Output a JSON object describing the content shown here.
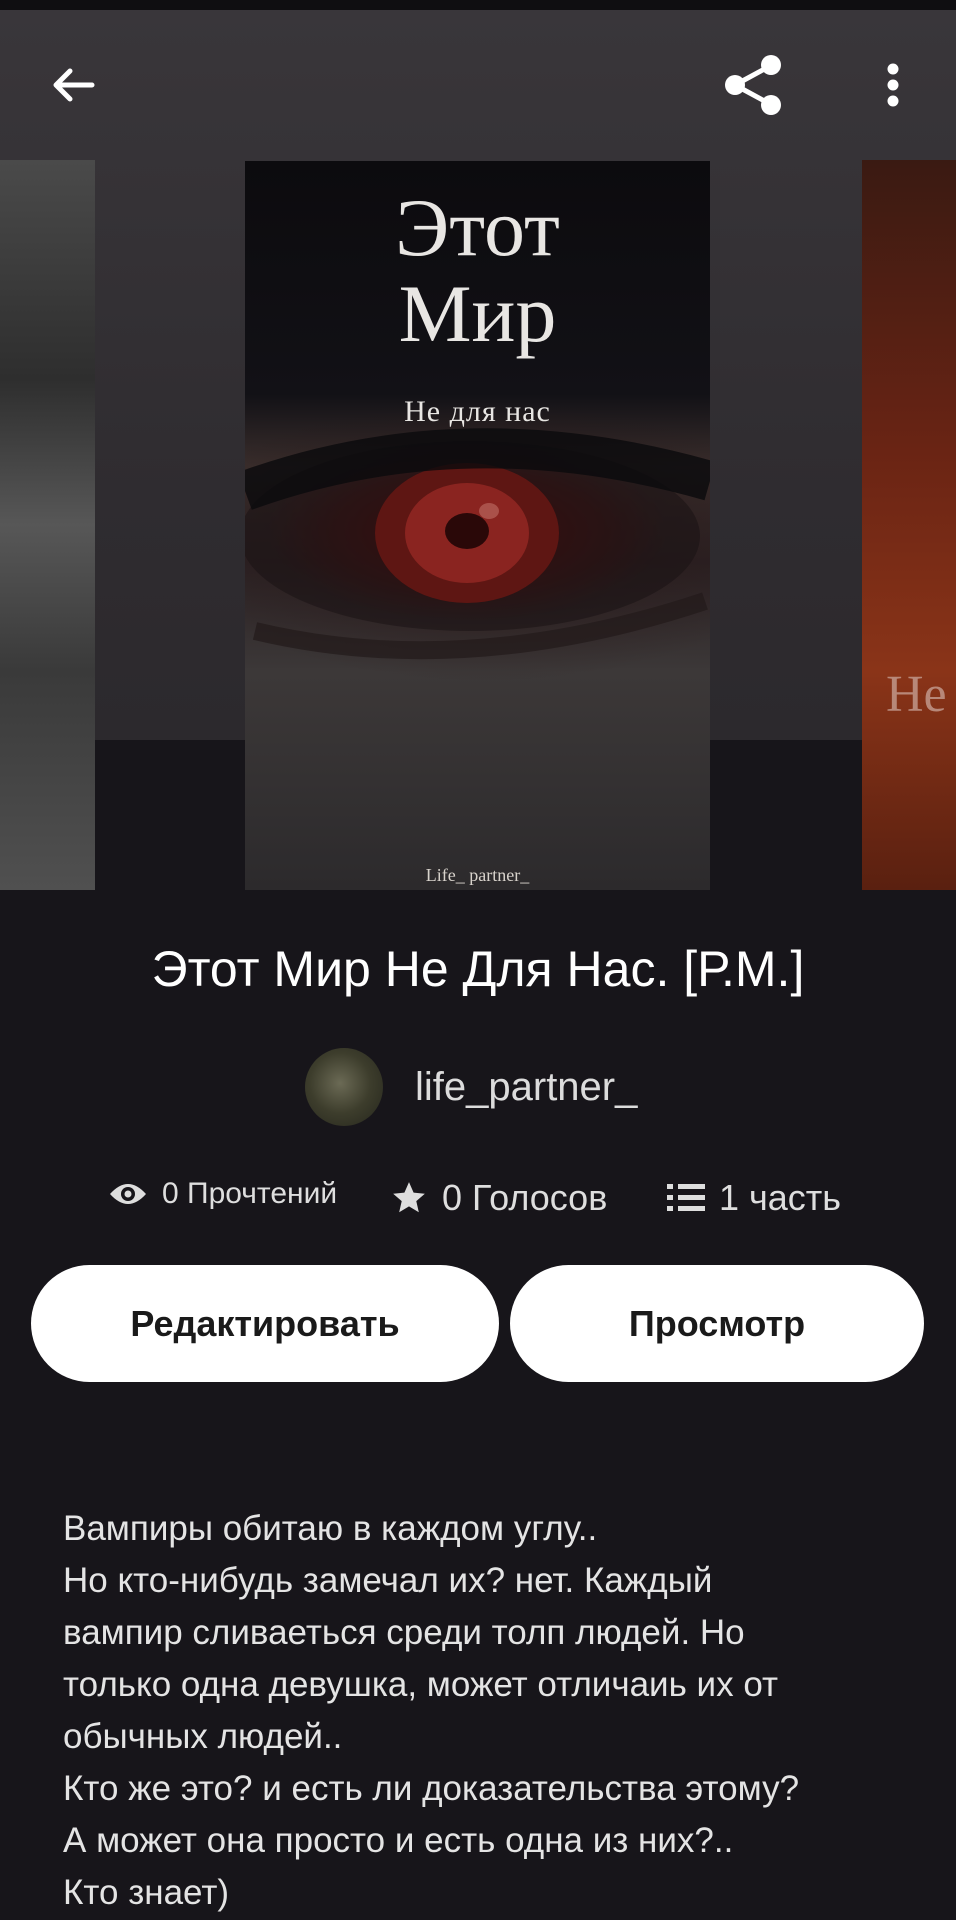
{
  "toolbar": {
    "back_icon": "arrow-left-icon",
    "share_icon": "share-icon",
    "more_icon": "more-vertical-icon"
  },
  "cover": {
    "title_line1": "Этот",
    "title_line2": "Мир",
    "subtitle": "Не для нас",
    "signature": "Life_ partner_",
    "right_cover_text": "Не"
  },
  "book": {
    "title": "Этот Мир Не Для Нас. [Р.М.]",
    "author": "life_partner_"
  },
  "stats": {
    "reads": "0 Прочтений",
    "votes": "0 Голосов",
    "parts": "1 часть"
  },
  "actions": {
    "edit_label": "Редактировать",
    "preview_label": "Просмотр"
  },
  "description": {
    "lines": [
      "Вампиры обитаю в каждом углу..",
      "Но кто-нибудь замечал их? нет. Каждый",
      "вампир сливаеться среди толп людей. Но",
      "только одна девушка, может отличаиь их от",
      "обычных людей..",
      "Кто же это? и есть ли доказательства этому?",
      "А может она просто и есть одна из них?..",
      "Кто знает)"
    ]
  },
  "colors": {
    "background": "#17151a",
    "button_bg": "#ffffff",
    "button_text": "#1a1a1a",
    "text_primary": "#ffffff",
    "text_secondary": "#dedede"
  }
}
